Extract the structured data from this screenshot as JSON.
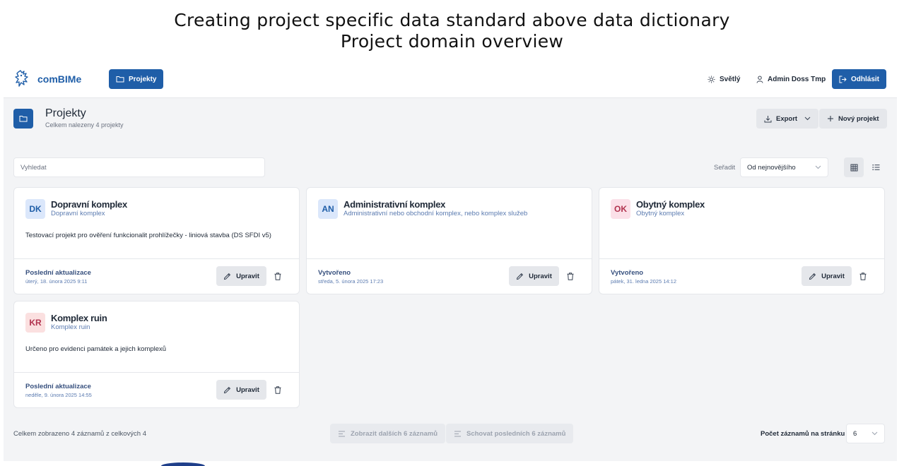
{
  "slide": {
    "title_line1": "Creating project specific data standard above data dictionary",
    "title_line2": "Project domain overview"
  },
  "header": {
    "brand": "comBIMe",
    "nav_projects": "Projekty",
    "theme": "Světlý",
    "user": "Admin Doss Tmp",
    "logout": "Odhlásit"
  },
  "page": {
    "title": "Projekty",
    "subtitle": "Celkem nalezeny 4 projekty",
    "export": "Export",
    "new_project": "Nový projekt"
  },
  "toolbar": {
    "search_placeholder": "Vyhledat",
    "sort_label": "Seřadit",
    "sort_value": "Od nejnovějšího"
  },
  "projects": [
    {
      "badge": "DK",
      "badge_bg": "#dbe7fb",
      "badge_color": "#1f5ea8",
      "title": "Dopravní komplex",
      "subtitle": "Dopravní komplex",
      "description": "Testovací projekt pro ověření funkcionalit prohlížečky - liniová stavba (DS SFDI v5)",
      "meta_label": "Poslední aktualizace",
      "meta_value": "úterý, 18. února 2025 9:11",
      "edit": "Upravit"
    },
    {
      "badge": "AN",
      "badge_bg": "#dbe7fb",
      "badge_color": "#1f5ea8",
      "title": "Administrativní komplex",
      "subtitle": "Administrativní nebo obchodní komplex, nebo komplex služeb",
      "description": "",
      "meta_label": "Vytvořeno",
      "meta_value": "středa, 5. února 2025 17:23",
      "edit": "Upravit"
    },
    {
      "badge": "OK",
      "badge_bg": "#fbe0e8",
      "badge_color": "#b1334f",
      "title": "Obytný komplex",
      "subtitle": "Obytný komplex",
      "description": "",
      "meta_label": "Vytvořeno",
      "meta_value": "pátek, 31. ledna 2025 14:12",
      "edit": "Upravit"
    },
    {
      "badge": "KR",
      "badge_bg": "#fbe0e0",
      "badge_color": "#b1334f",
      "title": "Komplex ruin",
      "subtitle": "Komplex ruin",
      "description": "Určeno pro evidenci památek a jejich komplexů",
      "meta_label": "Poslední aktualizace",
      "meta_value": "neděle, 9. února 2025 14:55",
      "edit": "Upravit"
    }
  ],
  "footer": {
    "summary": "Celkem zobrazeno 4 záznamů z celkových 4",
    "show_more": "Zobrazit dalších 6 záznamů",
    "hide_last": "Schovat posledních 6 záznamů",
    "per_page_label": "Počet záznamů na stránku",
    "per_page_value": "6"
  },
  "icons": {
    "logo": "lion-logo-icon",
    "folder": "folder-icon",
    "sun": "sun-icon",
    "user": "user-icon",
    "logout": "logout-icon",
    "download": "download-icon",
    "plus": "plus-icon",
    "chevron": "chevron-down-icon",
    "grid": "grid-view-icon",
    "list": "list-view-icon",
    "pencil": "pencil-icon",
    "trash": "trash-icon",
    "lines": "lines-icon"
  },
  "colors": {
    "primary": "#1f5ea8",
    "background": "#f3f4f6"
  }
}
